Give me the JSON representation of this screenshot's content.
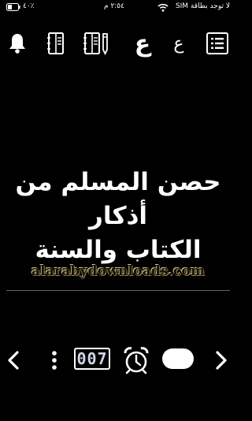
{
  "status_bar": {
    "carrier": "لا توجد بطاقة SIM",
    "time": "٢:٥٤ م",
    "battery_text": "٤٠٪",
    "battery_level": 0.4
  },
  "toolbar": {
    "letter_large": "ع",
    "letter_small": "ع"
  },
  "main": {
    "title_line1": "حصن المسلم من أذكار",
    "title_line2": "الكتاب والسنة",
    "watermark": "alarabydownloads.com"
  },
  "bottom_bar": {
    "counter_value": "007"
  }
}
